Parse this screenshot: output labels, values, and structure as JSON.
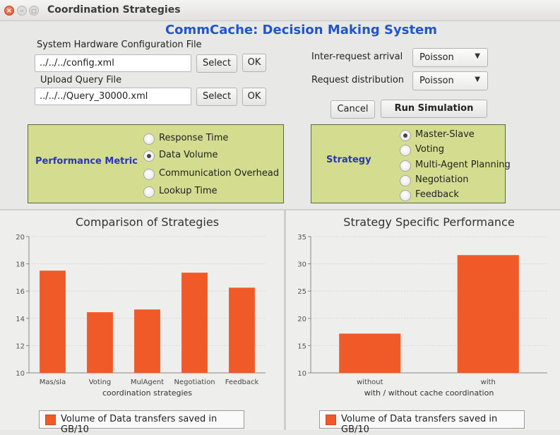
{
  "window": {
    "title": "Coordination Strategies",
    "close_glyph": "×",
    "min_glyph": "–",
    "max_glyph": "□"
  },
  "app_title": "CommCache: Decision Making System",
  "hardware": {
    "label": "System Hardware Configuration File",
    "value": "../../../config.xml",
    "select_label": "Select",
    "ok_label": "OK"
  },
  "query": {
    "label": "Upload Query File",
    "value": "../../../Query_30000.xml",
    "select_label": "Select",
    "ok_label": "OK"
  },
  "inter_request": {
    "label": "Inter-request arrival",
    "selected": "Poisson"
  },
  "request_dist": {
    "label": "Request distribution",
    "selected": "Poisson"
  },
  "actions": {
    "cancel_label": "Cancel",
    "run_label": "Run Simulation"
  },
  "metric": {
    "title": "Performance Metric",
    "options": [
      "Response Time",
      "Data Volume",
      "Communication Overhead",
      "Lookup Time"
    ],
    "selected_index": 1
  },
  "strategy": {
    "title": "Strategy",
    "options": [
      "Master-Slave",
      "Voting",
      "Multi-Agent Planning",
      "Negotiation",
      "Feedback"
    ],
    "selected_index": 0
  },
  "colors": {
    "bar": "#f05a28",
    "accent": "#2255cc",
    "box": "#d4dc8f"
  },
  "chart_data": [
    {
      "type": "bar",
      "title": "Comparison of Strategies",
      "xlabel": "coordination strategies",
      "ylabel": "",
      "categories": [
        "Mas/sla",
        "Voting",
        "MulAgent",
        "Negotiation",
        "Feedback"
      ],
      "series": [
        {
          "name": "Volume of Data transfers saved in GB/10",
          "values": [
            17.5,
            14.45,
            14.65,
            17.35,
            16.25
          ]
        }
      ],
      "ylim": [
        10,
        20
      ],
      "yticks": [
        10,
        12,
        14,
        16,
        18,
        20
      ],
      "grid": true,
      "legend": "bottom"
    },
    {
      "type": "bar",
      "title": "Strategy Specific Performance",
      "xlabel": "with / without cache coordination",
      "ylabel": "",
      "categories": [
        "without",
        "with"
      ],
      "series": [
        {
          "name": "Volume of Data transfers saved in GB/10",
          "values": [
            17.2,
            31.6
          ]
        }
      ],
      "ylim": [
        10,
        35
      ],
      "yticks": [
        10,
        15,
        20,
        25,
        30,
        35
      ],
      "grid": true,
      "legend": "bottom"
    }
  ]
}
